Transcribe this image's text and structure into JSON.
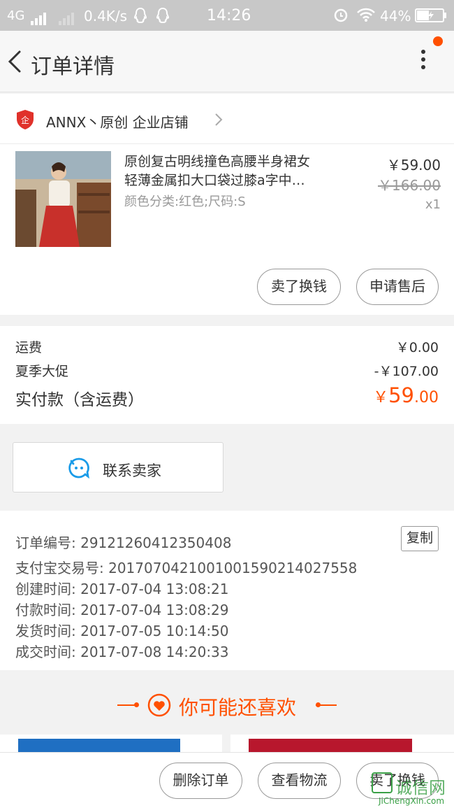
{
  "status_bar": {
    "network": "4G",
    "speed": "0.4K/s",
    "time": "14:26",
    "battery": "44%"
  },
  "header": {
    "title": "订单详情"
  },
  "shop": {
    "name": "ANNX丶原创 企业店铺",
    "badge_text": "企"
  },
  "product": {
    "title_line1": "原创复古明线撞色高腰半身裙女",
    "title_line2": "轻薄金属扣大口袋过膝a字中…",
    "sku": "颜色分类:红色;尺码:S",
    "price": "￥59.00",
    "original_price": "￥166.00",
    "quantity": "x1"
  },
  "actions": {
    "resell": "卖了换钱",
    "after_sale": "申请售后"
  },
  "costs": {
    "shipping_label": "运费",
    "shipping_value": "￥0.00",
    "promo_label": "夏季大促",
    "promo_value": "-￥107.00",
    "paid_label": "实付款（含运费）",
    "paid_currency": "￥",
    "paid_int": "59",
    "paid_dec": ".00"
  },
  "contact": {
    "label": "联系卖家"
  },
  "order_info": {
    "order_no": "订单编号:  29121260412350408",
    "alipay_no": "支付宝交易号:  2017070421001001590214027558",
    "created": "创建时间:  2017-07-04 13:08:21",
    "paid": "付款时间:  2017-07-04 13:08:29",
    "shipped": "发货时间:  2017-07-05 10:14:50",
    "completed": "成交时间:  2017-07-08 14:20:33",
    "copy_label": "复制"
  },
  "recommend": {
    "title": "你可能还喜欢"
  },
  "bottom_bar": {
    "delete": "删除订单",
    "logistics": "查看物流",
    "resell": "卖了换钱"
  },
  "watermark": {
    "text": "诚信网",
    "url": "JiChengXin.com"
  },
  "colors": {
    "accent": "#ff5000",
    "chat_blue": "#1a9be8",
    "shop_red": "#e0312a",
    "watermark_green": "#3aa046"
  }
}
